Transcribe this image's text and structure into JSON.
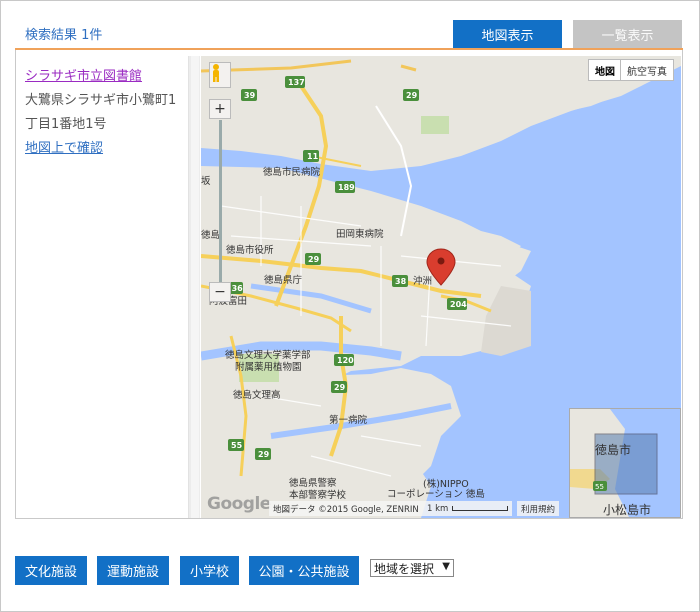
{
  "header": {
    "result_title": "検索結果 1件",
    "tab_map": "地図表示",
    "tab_list": "一覧表示"
  },
  "result": {
    "name": "シラサギ市立図書館",
    "address_line1": "大鷺県シラサギ市小鷺町1",
    "address_line2": "丁目1番地1号",
    "map_link": "地図上で確認"
  },
  "map": {
    "type_map": "地図",
    "type_satellite": "航空写真",
    "zoom_in": "+",
    "zoom_out": "−",
    "logo": "Google",
    "attribution": "地図データ ©2015 Google, ZENRIN",
    "scale": "1 km",
    "terms": "利用規約",
    "labels": {
      "hospital_city": "徳島市民病院",
      "hospital_tabata": "田岡東病院",
      "city_office": "徳島市役所",
      "pref_office": "徳島県庁",
      "awa_tomida": "阿波富田",
      "tokushima": "徳島",
      "okinosu": "沖洲",
      "bunri_univ": "徳島文理大学薬学部",
      "herb_garden": "附属薬用植物園",
      "bunri_high": "徳島文理高",
      "daiichi_hospital": "第一病院",
      "police": "徳島県警察",
      "police_hq": "本部警察学校",
      "nippo": "(株)NIPPO",
      "nippo_corp": "コーポレーション 徳島",
      "kitajima_left": "坂",
      "tsu": "津"
    },
    "route_numbers": [
      "137",
      "29",
      "39",
      "11",
      "189",
      "29",
      "38",
      "204",
      "136",
      "120",
      "29",
      "55",
      "29",
      "55"
    ],
    "inset": {
      "city1": "徳島市",
      "city2": "小松島市",
      "route": "55"
    }
  },
  "categories": {
    "culture": "文化施設",
    "sports": "運動施設",
    "school": "小学校",
    "park": "公園・公共施設"
  },
  "region_select": {
    "selected": "地域を選択"
  },
  "colors": {
    "accent_blue": "#1270c6",
    "link_blue": "#2f6fc1",
    "visited_purple": "#9a2bc2",
    "orange_rule": "#f0a25a",
    "water": "#a3c4ff",
    "land": "#e8e6df",
    "marker_red": "#d93d2e"
  }
}
